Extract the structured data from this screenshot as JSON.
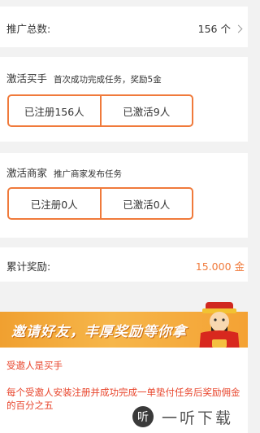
{
  "total": {
    "label": "推广总数:",
    "value": "156 个"
  },
  "buyer": {
    "title": "激活买手",
    "subtitle": "首次成功完成任务，奖励5金",
    "registered": "已注册156人",
    "activated": "已激活9人"
  },
  "merchant": {
    "title": "激活商家",
    "subtitle": "推广商家发布任务",
    "registered": "已注册0人",
    "activated": "已激活0人"
  },
  "reward": {
    "label": "累计奖励:",
    "value": "15.000 金"
  },
  "banner": {
    "text": "邀请好友，丰厚奖励等你拿"
  },
  "info": {
    "line1": "受邀人是买手",
    "line2": "每个受邀人安装注册并成功完成一单垫付任务后奖励佣金的百分之五"
  },
  "watermark": {
    "logo": "听",
    "text": "一听下载"
  },
  "colors": {
    "accent": "#f07a3b",
    "reward_value": "#f07a3b",
    "info_text": "#e8452c"
  }
}
